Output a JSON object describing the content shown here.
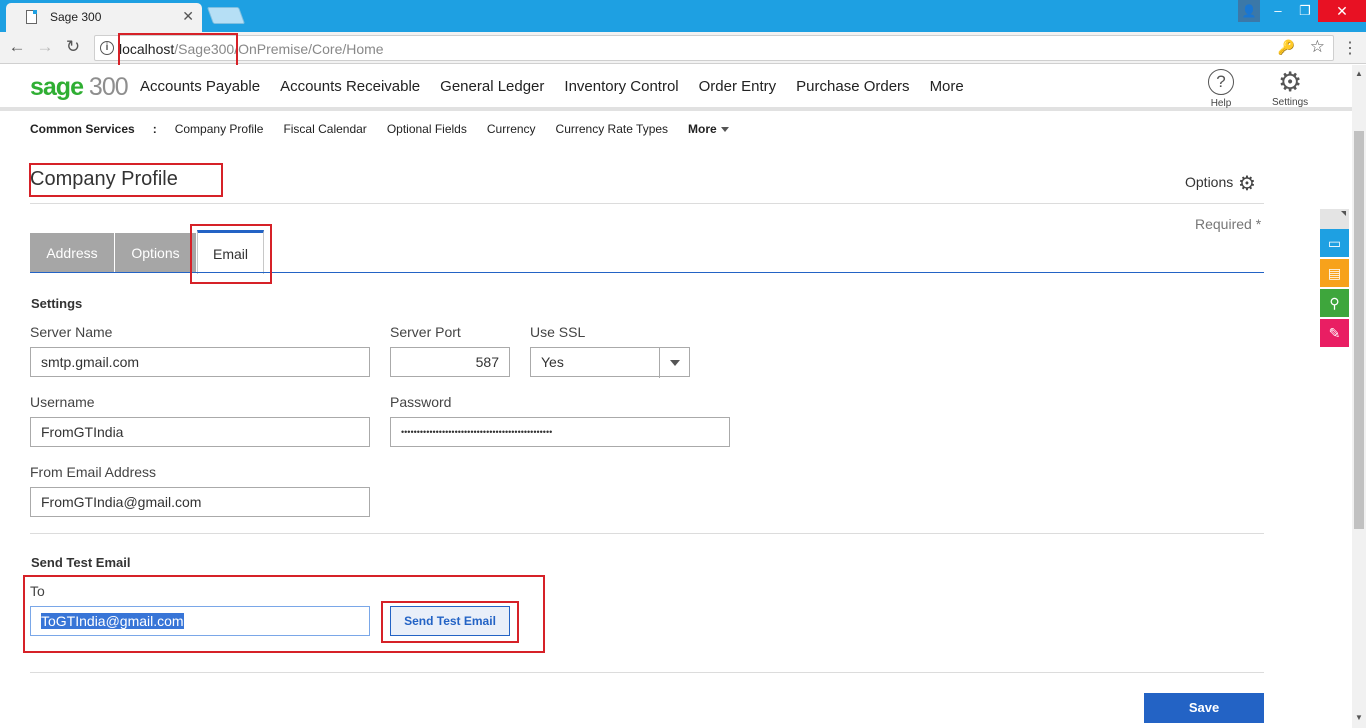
{
  "browser": {
    "tab_title": "Sage 300",
    "tab_close": "✕",
    "url_host": "localhost",
    "url_path": "/Sage300/OnPremise/Core/Home",
    "win_min": "–",
    "win_restore": "❐",
    "win_close": "✕"
  },
  "app": {
    "logo_sage": "sage",
    "logo_num": " 300",
    "nav": [
      "Accounts Payable",
      "Accounts Receivable",
      "General Ledger",
      "Inventory Control",
      "Order Entry",
      "Purchase Orders",
      "More"
    ],
    "help_label": "Help",
    "settings_label": "Settings"
  },
  "breadcrumb": {
    "head": "Common Services",
    "sep": ":",
    "items": [
      "Company Profile",
      "Fiscal Calendar",
      "Optional Fields",
      "Currency",
      "Currency Rate Types"
    ],
    "more": "More"
  },
  "page": {
    "title": "Company Profile",
    "options_label": "Options",
    "required_label": "Required *",
    "tabs": [
      "Address",
      "Options",
      "Email"
    ],
    "active_tab": "Email"
  },
  "settings": {
    "section_title": "Settings",
    "server_name_label": "Server Name",
    "server_name": "smtp.gmail.com",
    "server_port_label": "Server Port",
    "server_port": "587",
    "use_ssl_label": "Use SSL",
    "use_ssl": "Yes",
    "username_label": "Username",
    "username": "FromGTIndia",
    "password_label": "Password",
    "password": "••••••••••••••••••••••••••••••••••••••••••••••••",
    "from_email_label": "From Email Address",
    "from_email": "FromGTIndia@gmail.com"
  },
  "test_email": {
    "section_title": "Send Test Email",
    "to_label": "To",
    "to_value": "ToGTIndia@gmail.com",
    "send_button": "Send Test Email"
  },
  "actions": {
    "save": "Save"
  },
  "colors": {
    "accent": "#2363c5",
    "sage_green": "#2fae33",
    "highlight_red": "#d62128",
    "quick_blue": "#1ea0e2",
    "quick_orange": "#f7a21b",
    "quick_green": "#3ea63c",
    "quick_pink": "#e91e63"
  }
}
